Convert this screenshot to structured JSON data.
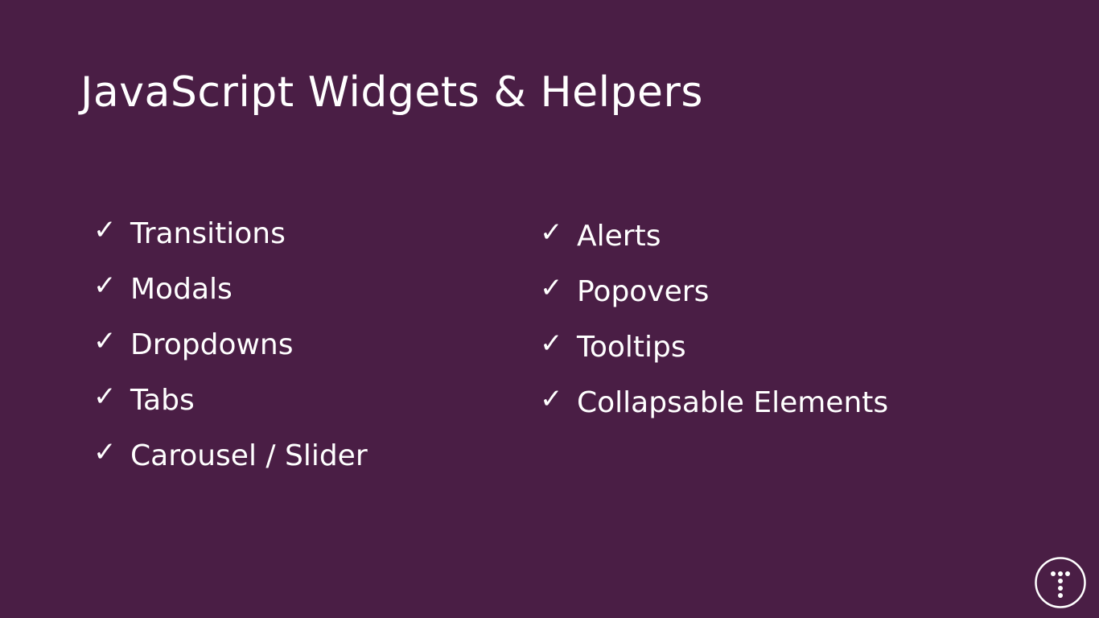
{
  "slide": {
    "title": "JavaScript Widgets & Helpers",
    "check_glyph": "✓",
    "left_items": [
      {
        "label": "Transitions"
      },
      {
        "label": "Modals"
      },
      {
        "label": "Dropdowns"
      },
      {
        "label": "Tabs"
      },
      {
        "label": "Carousel / Slider"
      }
    ],
    "right_items": [
      {
        "label": "Alerts"
      },
      {
        "label": "Popovers"
      },
      {
        "label": "Tooltips"
      },
      {
        "label": "Collapsable Elements"
      }
    ],
    "logo_icon": "traversy-t-logo",
    "colors": {
      "background": "#4a1e45",
      "text": "#ffffff"
    }
  }
}
